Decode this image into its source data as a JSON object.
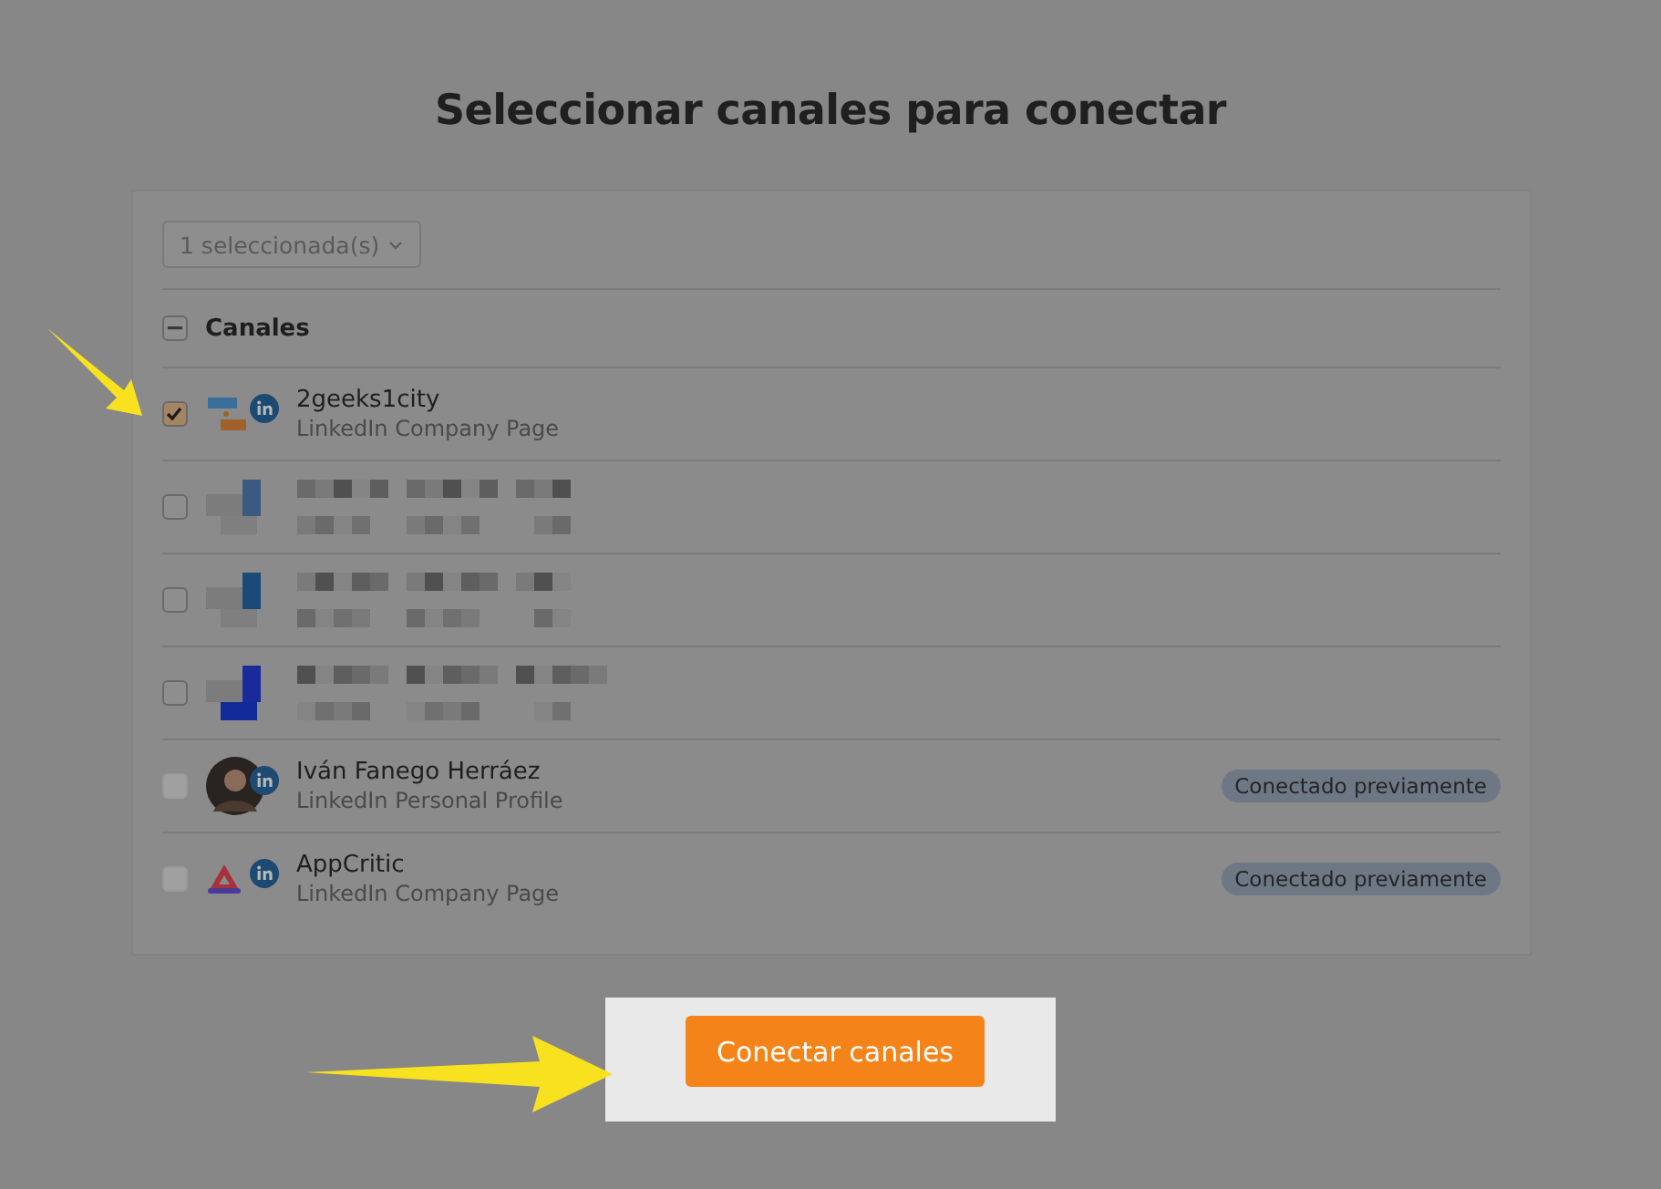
{
  "title": "Seleccionar canales para conectar",
  "filter": {
    "label": "1 seleccionada(s)"
  },
  "header": {
    "label": "Canales",
    "indeterminate": true
  },
  "channels": [
    {
      "kind": "channel",
      "avatar": {
        "kind": "logo"
      },
      "checked": true,
      "disabled": false,
      "name": "2geeks1city",
      "type": "LinkedIn Company Page"
    },
    {
      "kind": "redacted",
      "checked": false,
      "disabled": false
    },
    {
      "kind": "redacted",
      "checked": false,
      "disabled": false
    },
    {
      "kind": "redacted",
      "checked": false,
      "disabled": false
    },
    {
      "kind": "channel",
      "avatar": {
        "kind": "person"
      },
      "checked": false,
      "disabled": true,
      "name": "Iván Fanego Herráez",
      "type": "LinkedIn Personal Profile",
      "badge": "Conectado previamente"
    },
    {
      "kind": "channel",
      "avatar": {
        "kind": "triangle"
      },
      "checked": false,
      "disabled": true,
      "name": "AppCritic",
      "type": "LinkedIn Company Page",
      "badge": "Conectado previamente"
    }
  ],
  "button": {
    "label": "Conectar canales"
  }
}
